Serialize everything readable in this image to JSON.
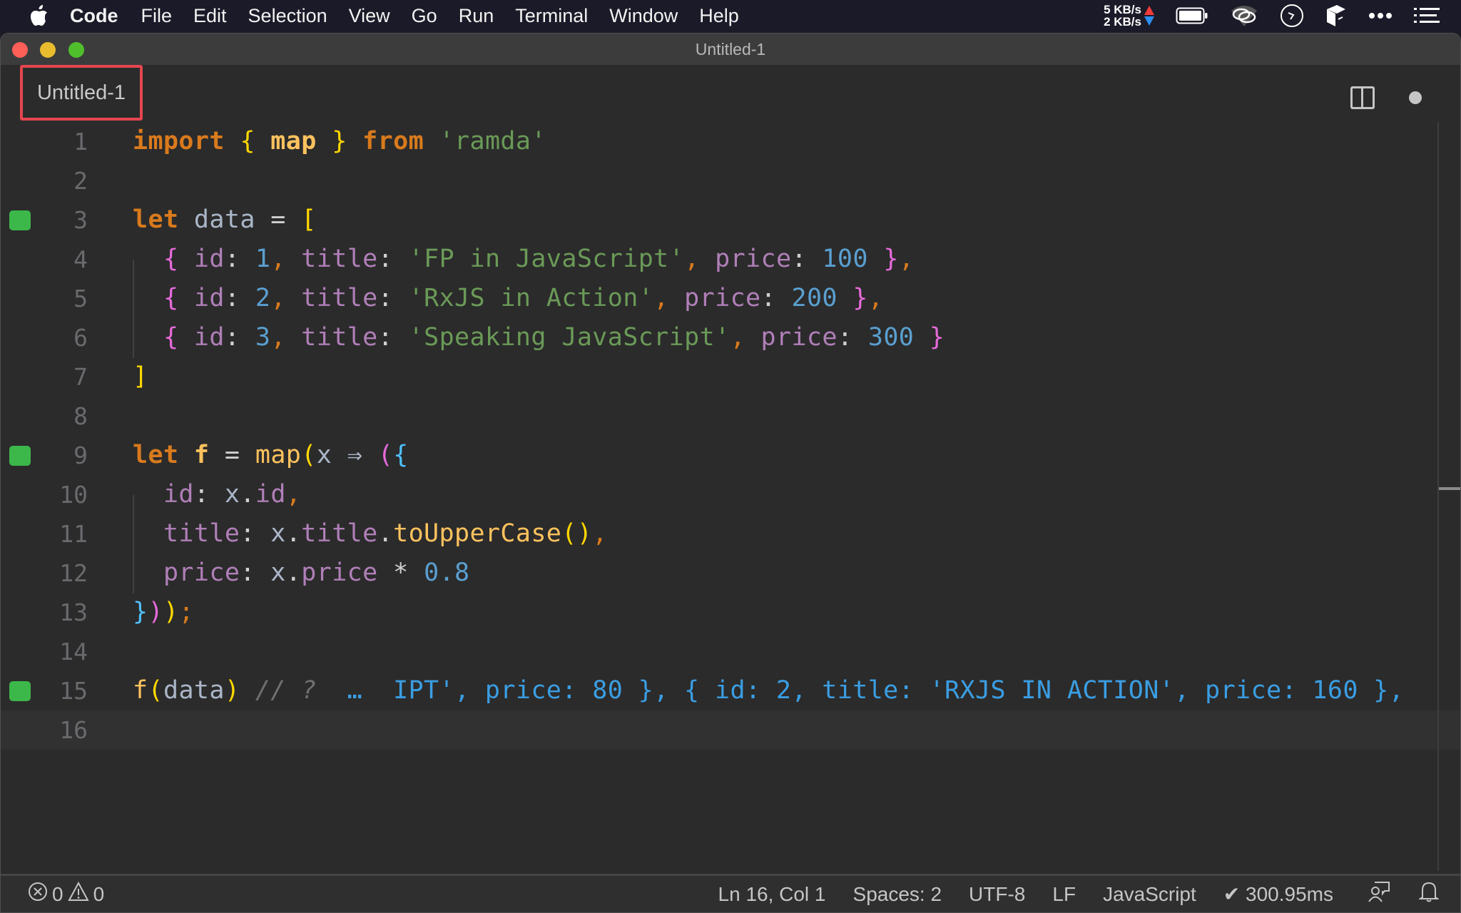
{
  "menubar": {
    "app": "Code",
    "items": [
      "File",
      "Edit",
      "Selection",
      "View",
      "Go",
      "Run",
      "Terminal",
      "Window",
      "Help"
    ],
    "net_up": "5 KB/s",
    "net_down": "2 KB/s"
  },
  "window": {
    "title": "Untitled-1"
  },
  "tab": {
    "label": "Untitled-1"
  },
  "editor": {
    "language": "JavaScript",
    "lines": [
      {
        "n": "1",
        "modified": false
      },
      {
        "n": "2",
        "modified": false
      },
      {
        "n": "3",
        "modified": true
      },
      {
        "n": "4",
        "modified": false
      },
      {
        "n": "5",
        "modified": false
      },
      {
        "n": "6",
        "modified": false
      },
      {
        "n": "7",
        "modified": false
      },
      {
        "n": "8",
        "modified": false
      },
      {
        "n": "9",
        "modified": true
      },
      {
        "n": "10",
        "modified": false
      },
      {
        "n": "11",
        "modified": false
      },
      {
        "n": "12",
        "modified": false
      },
      {
        "n": "13",
        "modified": false
      },
      {
        "n": "14",
        "modified": false
      },
      {
        "n": "15",
        "modified": true
      },
      {
        "n": "16",
        "modified": false
      }
    ],
    "code": {
      "l1": {
        "import": "import",
        "ob": "{",
        "map": "map",
        "cb": "}",
        "from": "from",
        "module": "'ramda'"
      },
      "l3": {
        "let": "let",
        "name": "data",
        "eq": "=",
        "open": "["
      },
      "records": [
        {
          "id": "1",
          "title": "'FP in JavaScript'",
          "price": "100",
          "trail": ","
        },
        {
          "id": "2",
          "title": "'RxJS in Action'",
          "price": "200",
          "trail": ","
        },
        {
          "id": "3",
          "title": "'Speaking JavaScript'",
          "price": "300",
          "trail": ""
        }
      ],
      "keys": {
        "id": "id",
        "title": "title",
        "price": "price"
      },
      "l7": {
        "close": "]"
      },
      "l9": {
        "let": "let",
        "name": "f",
        "eq": "=",
        "map": "map",
        "param": "x",
        "arrow": "⇒"
      },
      "l10": {
        "key": "id",
        "obj": "x",
        "prop": "id"
      },
      "l11": {
        "key": "title",
        "obj": "x",
        "prop": "title",
        "method": "toUpperCase"
      },
      "l12": {
        "key": "price",
        "obj": "x",
        "prop": "price",
        "op": "*",
        "num": "0.8"
      },
      "l13": {
        "close": "}));"
      },
      "l15": {
        "fn": "f",
        "arg": "data",
        "comment": "// ?",
        "result": "…  IPT', price: 80 }, { id: 2, title: 'RXJS IN ACTION', price: 160 },"
      }
    }
  },
  "statusbar": {
    "errors": "0",
    "warnings": "0",
    "position": "Ln 16, Col 1",
    "indent": "Spaces: 2",
    "encoding": "UTF-8",
    "eol": "LF",
    "language": "JavaScript",
    "timing": "✔ 300.95ms"
  },
  "colors": {
    "accent_highlight": "#e5464f",
    "gutter_modified": "#3bb849",
    "inline_result": "#3a9ee3"
  }
}
